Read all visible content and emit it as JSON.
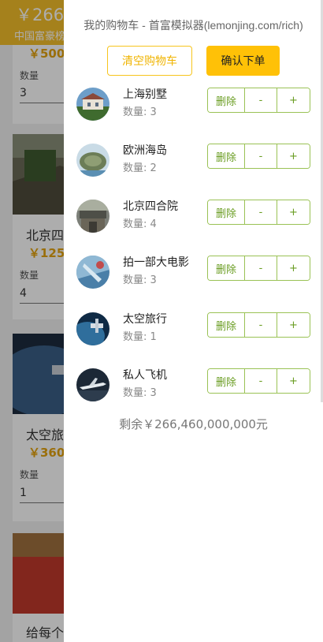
{
  "background": {
    "balance_text": "￥266,4",
    "site_text": "中国富豪榜",
    "cards": [
      {
        "title": "",
        "price": "￥5000",
        "qty_label": "数量",
        "qty_value": "3"
      },
      {
        "title": "北京四",
        "price": "￥125",
        "qty_label": "数量",
        "qty_value": "4"
      },
      {
        "title": "太空旅",
        "price": "￥360",
        "qty_label": "数量",
        "qty_value": "1"
      },
      {
        "title": "给每个",
        "price": "",
        "qty_label": "",
        "qty_value": ""
      }
    ]
  },
  "cart": {
    "title": "我的购物车 - 首富模拟器(lemonjing.com/rich)",
    "clear_label": "清空购物车",
    "order_label": "确认下单",
    "delete_label": "删除",
    "minus_label": "-",
    "plus_label": "+",
    "items": [
      {
        "name": "上海别墅",
        "qty_text": "数量: 3",
        "icon": "villa-image"
      },
      {
        "name": "欧洲海岛",
        "qty_text": "数量: 2",
        "icon": "island-image"
      },
      {
        "name": "北京四合院",
        "qty_text": "数量: 4",
        "icon": "courtyard-image"
      },
      {
        "name": "拍一部大电影",
        "qty_text": "数量: 3",
        "icon": "movie-image"
      },
      {
        "name": "太空旅行",
        "qty_text": "数量: 1",
        "icon": "space-image"
      },
      {
        "name": "私人飞机",
        "qty_text": "数量: 3",
        "icon": "jet-image"
      }
    ],
    "remaining_text": "剩余￥266,460,000,000元"
  },
  "colors": {
    "header": "#f4be2a",
    "price": "#e4a30f",
    "accent_yellow": "#ffc107",
    "green_border": "#9ac255",
    "green_text": "#6a9d22"
  }
}
